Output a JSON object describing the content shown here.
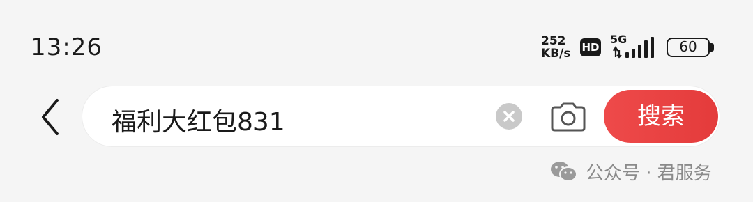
{
  "status_bar": {
    "time": "13:26",
    "net_speed_value": "252",
    "net_speed_unit": "KB/s",
    "hd_label": "HD",
    "network_type": "5G",
    "battery_level": "60",
    "icons": [
      "hd-icon",
      "signal-icon",
      "battery-icon"
    ]
  },
  "search": {
    "query": "福利大红包831",
    "button_label": "搜索",
    "accent_color": "#e8423f",
    "icons": [
      "back-icon",
      "clear-icon",
      "camera-icon"
    ]
  },
  "watermark": {
    "text": "公众号 · 君服务",
    "icon": "wechat-icon"
  }
}
